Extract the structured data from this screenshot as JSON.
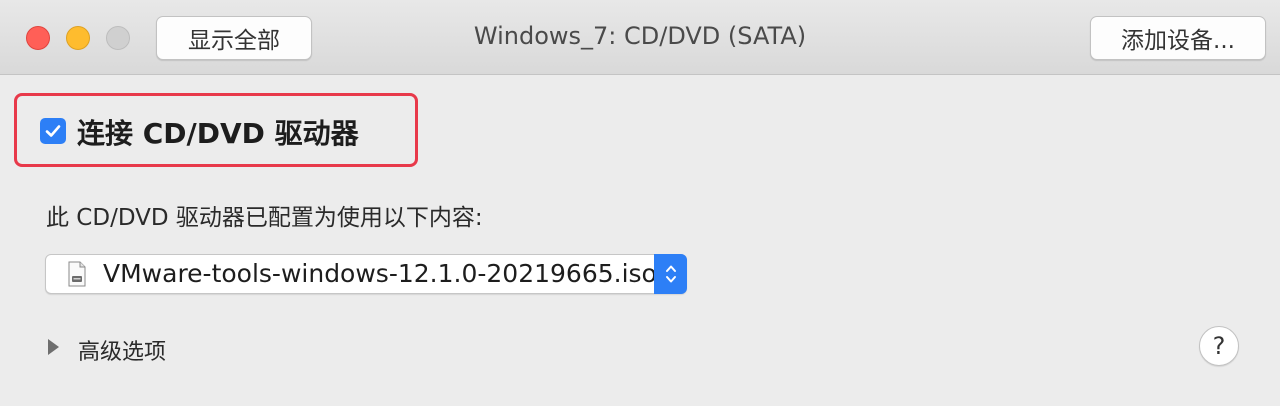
{
  "window": {
    "title": "Windows_7: CD/DVD (SATA)",
    "show_all_label": "显示全部",
    "add_device_label": "添加设备..."
  },
  "connect": {
    "label": "连接 CD/DVD 驱动器",
    "checked": true,
    "highlight_color": "#e8394a"
  },
  "config": {
    "description": "此 CD/DVD 驱动器已配置为使用以下内容:",
    "selected_file": "VMware-tools-windows-12.1.0-20219665.iso",
    "file_icon": "disk-image-icon"
  },
  "advanced": {
    "label": "高级选项",
    "icon": "disclosure-triangle-icon"
  },
  "help": {
    "label": "?"
  },
  "colors": {
    "accent": "#2d7ff6",
    "close": "#ff5f57",
    "minimize": "#febc2e"
  }
}
